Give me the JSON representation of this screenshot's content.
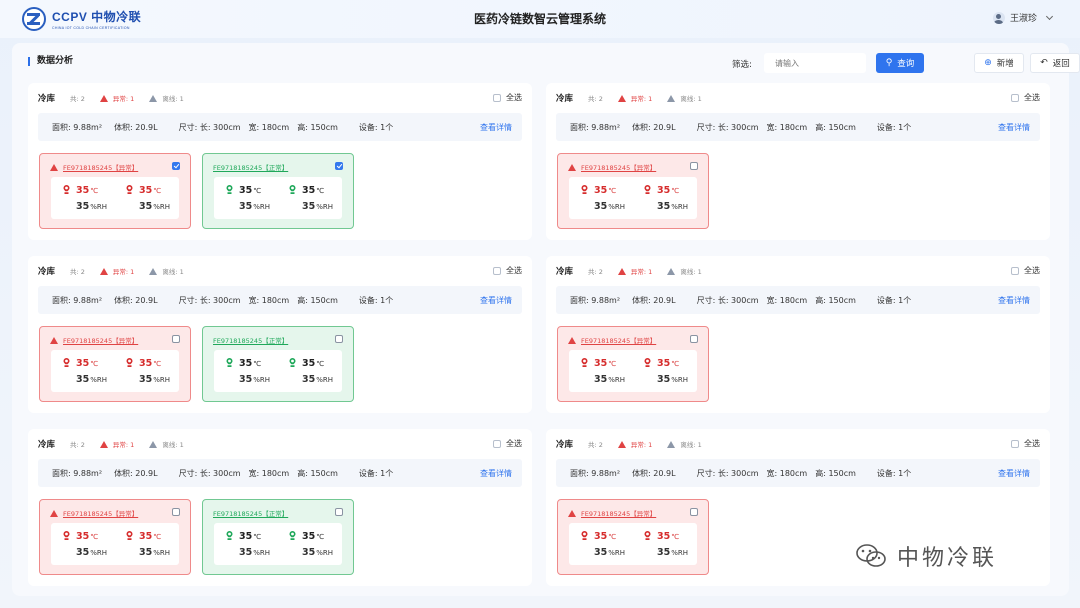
{
  "header": {
    "logo_main": "CCPV 中物冷联",
    "logo_sub": "CHINA IOT COLD CHAIN CERTIFICATION",
    "app_title": "医药冷链数智云管理系统",
    "user_name": "王淑珍"
  },
  "toolbar": {
    "section_title": "数据分析",
    "filter_label": "筛选:",
    "filter_placeholder": "请输入",
    "query_label": "查询",
    "add_label": "新增",
    "back_label": "返回"
  },
  "card_common": {
    "title": "冷库",
    "total": "共: 2",
    "abnormal": "异常: 1",
    "offline": "离线: 1",
    "select_all": "全选",
    "area": "面积: 9.88m²",
    "volume": "体积: 20.9L",
    "size_length": "尺寸: 长: 300cm",
    "size_width": "宽: 180cm",
    "size_height": "高: 150cm",
    "devices": "设备: 1个",
    "detail_link": "查看详情"
  },
  "devices": {
    "bad_id": "FE9718185245【异常】",
    "good_id": "FE9718185245【正常】",
    "temp_value": "35",
    "temp_unit": "℃",
    "hum_value": "35",
    "hum_unit": "%RH"
  },
  "cards": [
    {
      "has_good": true,
      "bad_checked": true,
      "good_checked": true
    },
    {
      "has_good": false,
      "bad_checked": false
    },
    {
      "has_good": true,
      "bad_checked": false,
      "good_checked": false
    },
    {
      "has_good": false,
      "bad_checked": false
    },
    {
      "has_good": true,
      "bad_checked": false,
      "good_checked": false
    },
    {
      "has_good": false,
      "bad_checked": false
    }
  ],
  "watermark": "中物冷联",
  "colors": {
    "primary": "#2f74ee",
    "abnormal": "#e04343",
    "normal": "#1fa85a"
  }
}
